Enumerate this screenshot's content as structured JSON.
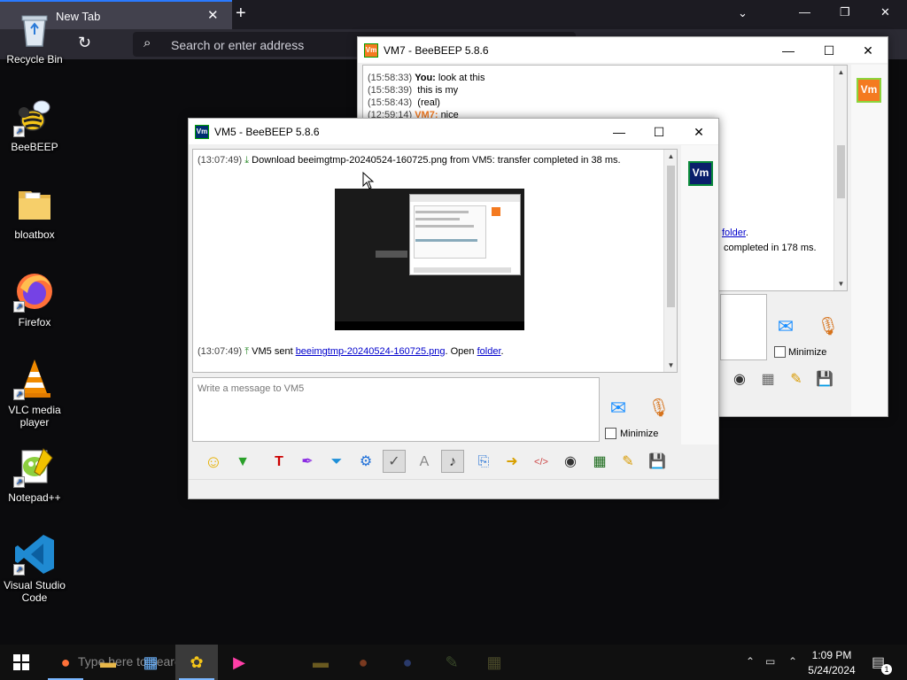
{
  "browser": {
    "tab_title": "New Tab",
    "tab_close": "✕",
    "new_tab": "+",
    "tab_list": "⌄",
    "minimize": "—",
    "maximize": "❐",
    "close": "✕",
    "reload": "↻",
    "search_icon": "⌕",
    "address_placeholder": "Search or enter address"
  },
  "desktop": {
    "icons": [
      {
        "label": "Recycle Bin",
        "icon": "recycle-bin-icon"
      },
      {
        "label": "BeeBEEP",
        "icon": "bee-icon"
      },
      {
        "label": "bloatbox",
        "icon": "folder-icon"
      },
      {
        "label": "Firefox",
        "icon": "firefox-icon"
      },
      {
        "label": "VLC media player",
        "icon": "vlc-cone-icon"
      },
      {
        "label": "Notepad++",
        "icon": "notepadpp-icon"
      },
      {
        "label": "Visual Studio Code",
        "icon": "vscode-icon"
      }
    ]
  },
  "vm7_window": {
    "title": "VM7 - BeeBEEP 5.8.6",
    "app_icon_text": "Vm",
    "badge": "Vm",
    "badge_color": "#f47a20",
    "minimize_btn": "—",
    "maximize_btn": "☐",
    "close_btn": "✕",
    "messages": [
      {
        "time": "(15:58:33)",
        "sender": "You:",
        "text": "look at this"
      },
      {
        "time": "(15:58:39)",
        "sender": "",
        "text": "this is my"
      },
      {
        "time": "(15:58:43)",
        "sender": "",
        "text": "(real)"
      },
      {
        "time": "(12:59:14)",
        "sender": "VM7:",
        "text": "nice"
      }
    ],
    "partial_link": "folder",
    "partial_period": ".",
    "partial_transfer": "completed in 178 ms.",
    "minimize_label": "Minimize"
  },
  "vm5_window": {
    "title": "VM5 - BeeBEEP 5.8.6",
    "app_icon_text": "Vm",
    "badge": "Vm",
    "badge_color": "#0a1f6b",
    "minimize_btn": "—",
    "maximize_btn": "☐",
    "close_btn": "✕",
    "line1": {
      "time": "(13:07:49)",
      "text": "Download beeimgtmp-20240524-160725.png from VM5: transfer completed in 38 ms."
    },
    "line2": {
      "time": "(13:07:49)",
      "prefix": "VM5 sent",
      "file_link": "beeimgtmp-20240524-160725.png",
      "middle": ". Open",
      "folder_link": "folder",
      "suffix": "."
    },
    "message_placeholder": "Write a message to VM5",
    "minimize_label": "Minimize"
  },
  "toolbar_icons": [
    "emoticon-icon",
    "collapse-icon",
    "font-icon",
    "color-icon",
    "filter-icon",
    "settings-icon",
    "spellcheck-icon",
    "bold-icon",
    "file-icon",
    "export-icon",
    "folder-share-icon",
    "html-icon",
    "screenshot-icon",
    "picture-icon",
    "edit-icon",
    "save-icon"
  ],
  "taskbar": {
    "search_placeholder": "Type here to search",
    "clock_time": "1:09 PM",
    "clock_date": "5/24/2024",
    "notification_count": "1"
  }
}
